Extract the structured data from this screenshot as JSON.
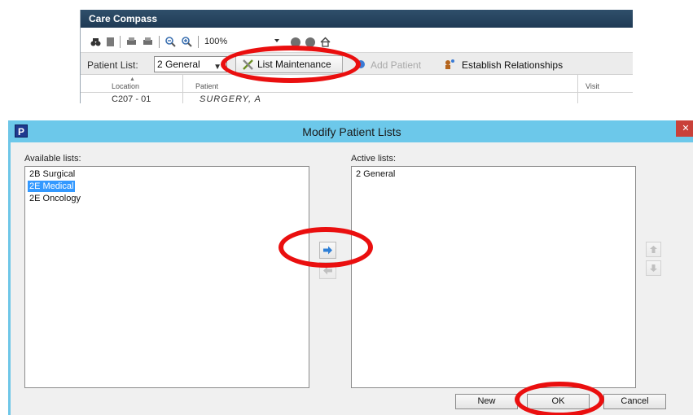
{
  "care_compass": {
    "title": "Care Compass",
    "toolbar": {
      "zoom_value": "100%",
      "icons": [
        "binoculars-icon",
        "document-icon",
        "print-icon",
        "print-preview-icon",
        "zoom-out-icon",
        "zoom-in-icon",
        "circle-icon",
        "circle-icon",
        "home-icon"
      ]
    },
    "patient_list_label": "Patient List:",
    "patient_list_value": "2 General",
    "list_maintenance_label": "List Maintenance",
    "add_patient_label": "Add Patient",
    "establish_relationships_label": "Establish Relationships",
    "columns": {
      "location": "Location",
      "patient": "Patient",
      "visit": "Visit"
    },
    "partial_row": {
      "location": "C207 - 01",
      "patient": "SURGERY, A"
    }
  },
  "dialog": {
    "title": "Modify Patient Lists",
    "icon_letter": "P",
    "close_label": "✕",
    "available_label": "Available lists:",
    "available_items": [
      "2B Surgical",
      "2E Medical",
      "2E Oncology"
    ],
    "selected_available": "2E Medical",
    "active_label": "Active lists:",
    "active_items": [
      "2 General"
    ],
    "buttons": {
      "new": "New",
      "ok": "OK",
      "cancel": "Cancel"
    }
  },
  "colors": {
    "dialog_title_bar": "#6cc8ea",
    "selection": "#3399ff",
    "annotation_ring": "#ea0f0f",
    "care_compass_title_bar": "#2f4f6b"
  }
}
